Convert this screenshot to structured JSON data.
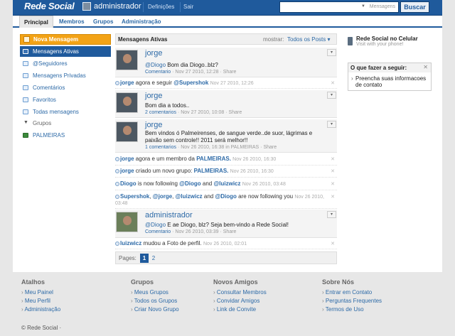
{
  "brand": "Rede Social",
  "topbar": {
    "user_name": "administrador",
    "settings": "Definições",
    "logout": "Sair",
    "search_placeholder": "Mensagens",
    "search_button": "Buscar"
  },
  "nav": [
    "Principal",
    "Membros",
    "Grupos",
    "Administração"
  ],
  "sidebar": {
    "new_message": "Nova Mensagem",
    "items": [
      "Mensagens Ativas",
      "@Seguidores",
      "Mensagens Privadas",
      "Comentários",
      "Favoritos",
      "Todas mensagens"
    ],
    "groups_header": "Grupos",
    "group_items": [
      "PALMEIRAS"
    ]
  },
  "main": {
    "title": "Mensagens Ativas",
    "show_label": "mostrar:",
    "show_value": "Todos os Posts",
    "posts": [
      {
        "name": "jorge",
        "mention": "@Diogo",
        "text": "Bom dia Diogo..blz?",
        "comment": "Comentario",
        "date": "Nov 27 2010, 12:28",
        "share": "Share"
      },
      {
        "name": "jorge",
        "text": "Bom dia a todos..",
        "comment": "2 comentarios",
        "date": "Nov 27 2010, 10:08",
        "share": "Share"
      },
      {
        "name": "jorge",
        "text": "Bem vindos ó Palmeirenses, de sangue verde..de suor, lágrimas e paixão sem controle!! 2011 será melhor!!",
        "comment": "1 comentarios",
        "date": "Nov 26 2010, 16:38",
        "group": "in PALMEIRAS",
        "share": "Share"
      },
      {
        "name": "administrador",
        "mention": "@Diogo",
        "text": "E ae Diogo, blz? Seja bem-vindo a Rede Social!",
        "comment": "Comentario",
        "date": "Nov 26 2010, 03:39",
        "share": "Share"
      }
    ],
    "activities": [
      {
        "user": "jorge",
        "text": "agora e seguir",
        "target": "@Supershok",
        "time": "Nov 27 2010, 12:26"
      },
      {
        "user": "jorge",
        "text": "agora e um membro da",
        "target": "PALMEIRAS.",
        "time": "Nov 26 2010, 16:30"
      },
      {
        "user": "jorge",
        "text": "criado um novo grupo:",
        "target": "PALMEIRAS.",
        "time": "Nov 26 2010, 16:30"
      },
      {
        "user": "Diogo",
        "text": "is now following",
        "target": "@Diogo",
        "and": "and",
        "target2": "@luizwicz",
        "time": "Nov 26 2010, 03:48"
      },
      {
        "user": "Supershok",
        "u2": "@jorge",
        "u3": "@luizwicz",
        "and": "and",
        "u4": "@Diogo",
        "text": "are now following you",
        "time": "Nov 26 2010, 03:48"
      },
      {
        "user": "luizwicz",
        "text": "mudou a Foto de perfil.",
        "time": "Nov 26 2010, 02:01"
      }
    ],
    "pages_label": "Pages:",
    "pages": [
      "1",
      "2"
    ]
  },
  "right": {
    "mobile_title": "Rede Social no Celular",
    "mobile_sub": "Visit with your phone!",
    "todo_title": "O que fazer a seguir:",
    "todo_item": "Preencha suas informacoes de contato"
  },
  "footer": {
    "cols": [
      {
        "title": "Atalhos",
        "items": [
          "Meu Painel",
          "Meu Perfil",
          "Administração"
        ]
      },
      {
        "title": "Grupos",
        "items": [
          "Meus Grupos",
          "Todos os Grupos",
          "Criar Novo Grupo"
        ]
      },
      {
        "title": "Novos Amigos",
        "items": [
          "Consultar Membros",
          "Convidar Amigos",
          "Link de Convite"
        ]
      },
      {
        "title": "Sobre Nós",
        "items": [
          "Entrar em Contato",
          "Perguntas Frequentes",
          "Termos de Uso"
        ]
      }
    ],
    "copyright": "© Rede Social ·"
  },
  "icon_names": [
    "user-avatar-icon",
    "chevron-down-icon",
    "compose-icon",
    "list-icon",
    "at-icon",
    "mail-icon",
    "comment-icon",
    "star-icon",
    "all-icon",
    "phone-icon",
    "close-icon"
  ],
  "colors": {
    "brand_blue": "#1f5a9c",
    "accent_orange": "#f3a316",
    "link": "#2d6aa7"
  }
}
